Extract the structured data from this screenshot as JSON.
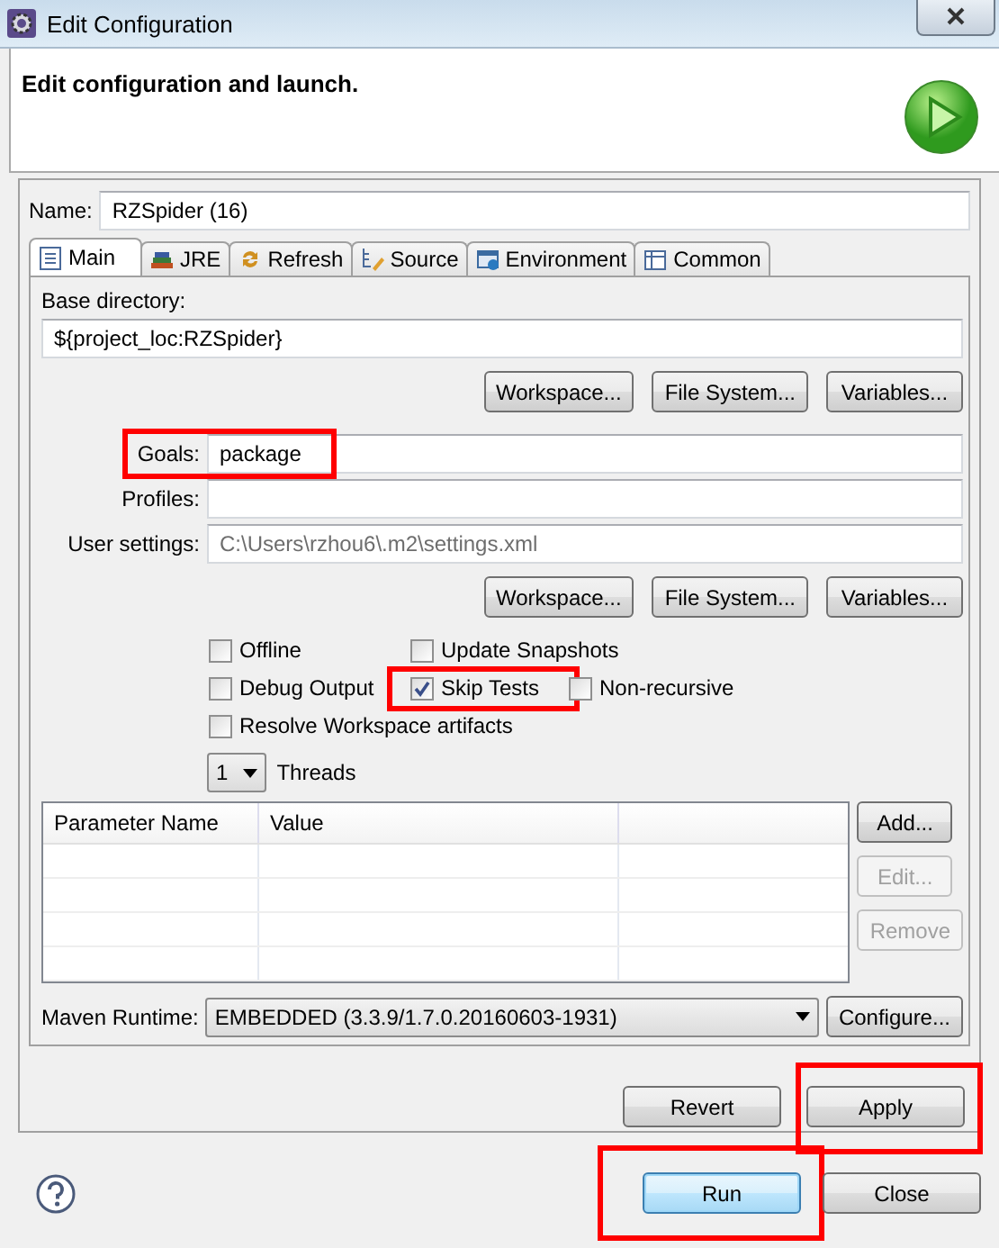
{
  "window": {
    "title": "Edit Configuration"
  },
  "header": {
    "title": "Edit configuration and launch."
  },
  "name_field": {
    "label": "Name:",
    "value": "RZSpider (16)"
  },
  "tabs": [
    {
      "label": "Main",
      "kind": "main",
      "selected": true
    },
    {
      "label": "JRE",
      "kind": "jre",
      "selected": false
    },
    {
      "label": "Refresh",
      "kind": "refresh",
      "selected": false
    },
    {
      "label": "Source",
      "kind": "source",
      "selected": false
    },
    {
      "label": "Environment",
      "kind": "environment",
      "selected": false
    },
    {
      "label": "Common",
      "kind": "common",
      "selected": false
    }
  ],
  "main_tab": {
    "base_directory": {
      "label": "Base directory:",
      "value": "${project_loc:RZSpider}",
      "buttons": [
        "Workspace...",
        "File System...",
        "Variables..."
      ]
    },
    "fields": [
      {
        "label": "Goals:",
        "value": "package",
        "highlighted": true
      },
      {
        "label": "Profiles:",
        "highlighted": false
      },
      {
        "label": "User settings:",
        "placeholder": "C:\\Users\\rzhou6\\.m2\\settings.xml",
        "highlighted": false
      }
    ],
    "settings_buttons": [
      "Workspace...",
      "File System...",
      "Variables..."
    ],
    "option_rows": [
      [
        {
          "label": "Offline",
          "checked": false,
          "highlighted": false
        },
        {
          "label": "Update Snapshots",
          "checked": false,
          "highlighted": false
        }
      ],
      [
        {
          "label": "Debug Output",
          "checked": false,
          "highlighted": false
        },
        {
          "label": "Skip Tests",
          "checked": true,
          "highlighted": true
        },
        {
          "label": "Non-recursive",
          "checked": false,
          "highlighted": false
        }
      ],
      [
        {
          "label": "Resolve Workspace artifacts",
          "checked": false,
          "highlighted": false
        }
      ]
    ],
    "threads": {
      "value": "1",
      "label": "Threads"
    },
    "parameters_table": {
      "columns": [
        "Parameter Name",
        "Value"
      ],
      "buttons": [
        {
          "label": "Add...",
          "disabled": false
        },
        {
          "label": "Edit...",
          "disabled": true
        },
        {
          "label": "Remove",
          "disabled": true
        }
      ]
    },
    "maven_runtime": {
      "label": "Maven Runtime:",
      "value": "EMBEDDED (3.3.9/1.7.0.20160603-1931)",
      "button": "Configure..."
    }
  },
  "config_buttons": [
    {
      "label": "Revert",
      "highlighted": false
    },
    {
      "label": "Apply",
      "highlighted": true
    }
  ],
  "dialog_buttons": [
    {
      "label": "Run",
      "default": true,
      "highlighted": true
    },
    {
      "label": "Close",
      "default": false,
      "highlighted": false
    }
  ]
}
